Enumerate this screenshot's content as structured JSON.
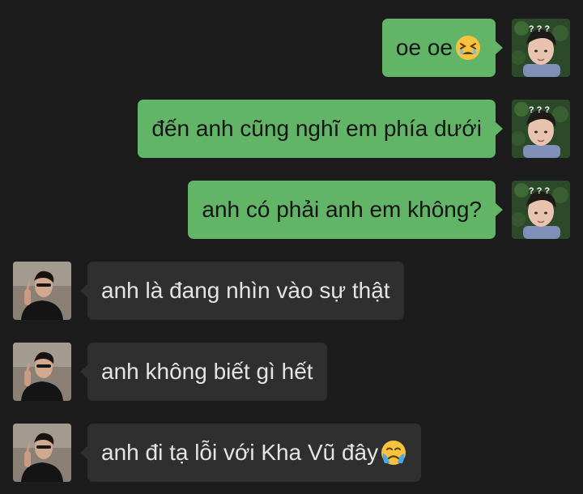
{
  "messages": [
    {
      "side": "outgoing",
      "text": "oe oe",
      "emoji": "tired-face-emoji",
      "avatar": "my-avatar"
    },
    {
      "side": "outgoing",
      "text": "đến anh cũng nghĩ em phía dưới",
      "avatar": "my-avatar"
    },
    {
      "side": "outgoing",
      "text": "anh có phải anh em không?",
      "avatar": "my-avatar"
    },
    {
      "side": "incoming",
      "text": "anh là đang nhìn vào sự thật",
      "avatar": "contact-avatar"
    },
    {
      "side": "incoming",
      "text": "anh không biết gì hết",
      "avatar": "contact-avatar"
    },
    {
      "side": "incoming",
      "text": "anh đi tạ lỗi với Kha Vũ đây",
      "emoji": "crying-face-emoji",
      "avatar": "contact-avatar"
    }
  ],
  "colors": {
    "background": "#1c1c1c",
    "outgoing_bubble": "#62b567",
    "incoming_bubble": "#2f2f2f",
    "outgoing_text": "#141414",
    "incoming_text": "#e4e4e4"
  },
  "my_avatar_overlay": "? ? ?"
}
